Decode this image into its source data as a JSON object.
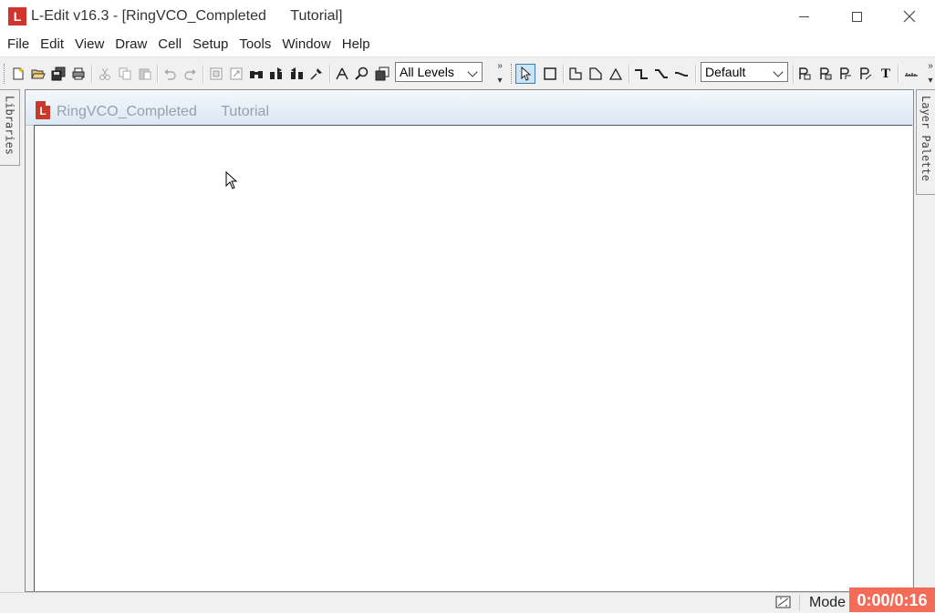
{
  "window": {
    "app_logo_letter": "L",
    "title": "L-Edit v16.3 - [RingVCO_Completed      Tutorial]"
  },
  "menu": [
    "File",
    "Edit",
    "View",
    "Draw",
    "Cell",
    "Setup",
    "Tools",
    "Window",
    "Help"
  ],
  "toolbar": {
    "levels_select": "All Levels",
    "style_select": "Default",
    "text_tool_label": "T"
  },
  "side_tabs": {
    "left": "Libraries",
    "right": "Layer Palette"
  },
  "document": {
    "icon_letter": "L",
    "title": "RingVCO_Completed      Tutorial"
  },
  "status": {
    "mode_label": "Mode",
    "timer": "0:00/0:16"
  },
  "colors": {
    "brand_red": "#d0342c",
    "timer_bg": "#f46b57",
    "active_tool_bg": "#cce4f7"
  }
}
